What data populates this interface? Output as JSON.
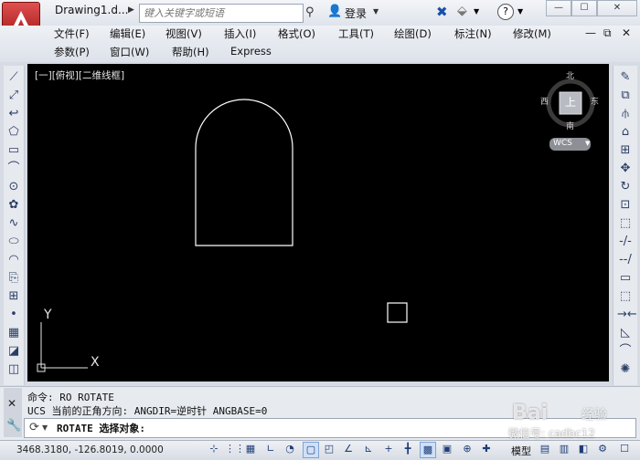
{
  "title_bar": {
    "doc_title": "Drawing1.d...",
    "search_placeholder": "键入关键字或短语",
    "login": "登录"
  },
  "menus_row1": [
    "文件(F)",
    "编辑(E)",
    "视图(V)",
    "插入(I)",
    "格式(O)",
    "工具(T)",
    "绘图(D)",
    "标注(N)",
    "修改(M)"
  ],
  "menus_row2": [
    "参数(P)",
    "窗口(W)",
    "帮助(H)",
    "Express"
  ],
  "viewport": {
    "label": "[一][俯视][二维线框]",
    "viewcube": {
      "north": "北",
      "south": "南",
      "west": "西",
      "east": "东",
      "face": "上",
      "wcs": "WCS"
    },
    "ucs": {
      "x": "X",
      "y": "Y"
    }
  },
  "command": {
    "line1": "命令: RO ROTATE",
    "line2": "UCS 当前的正角方向:  ANGDIR=逆时针  ANGBASE=0",
    "prompt": "ROTATE 选择对象:"
  },
  "status": {
    "coordinates": "3468.3180, -126.8019, 0.0000",
    "model": "模型"
  },
  "watermark": {
    "brand": "Bai",
    "suffix": "经验",
    "sub": "微信号: cadbc12"
  },
  "colors": {
    "app_red": "#c02020",
    "canvas": "#000000",
    "drawing_line": "#ffffff"
  }
}
